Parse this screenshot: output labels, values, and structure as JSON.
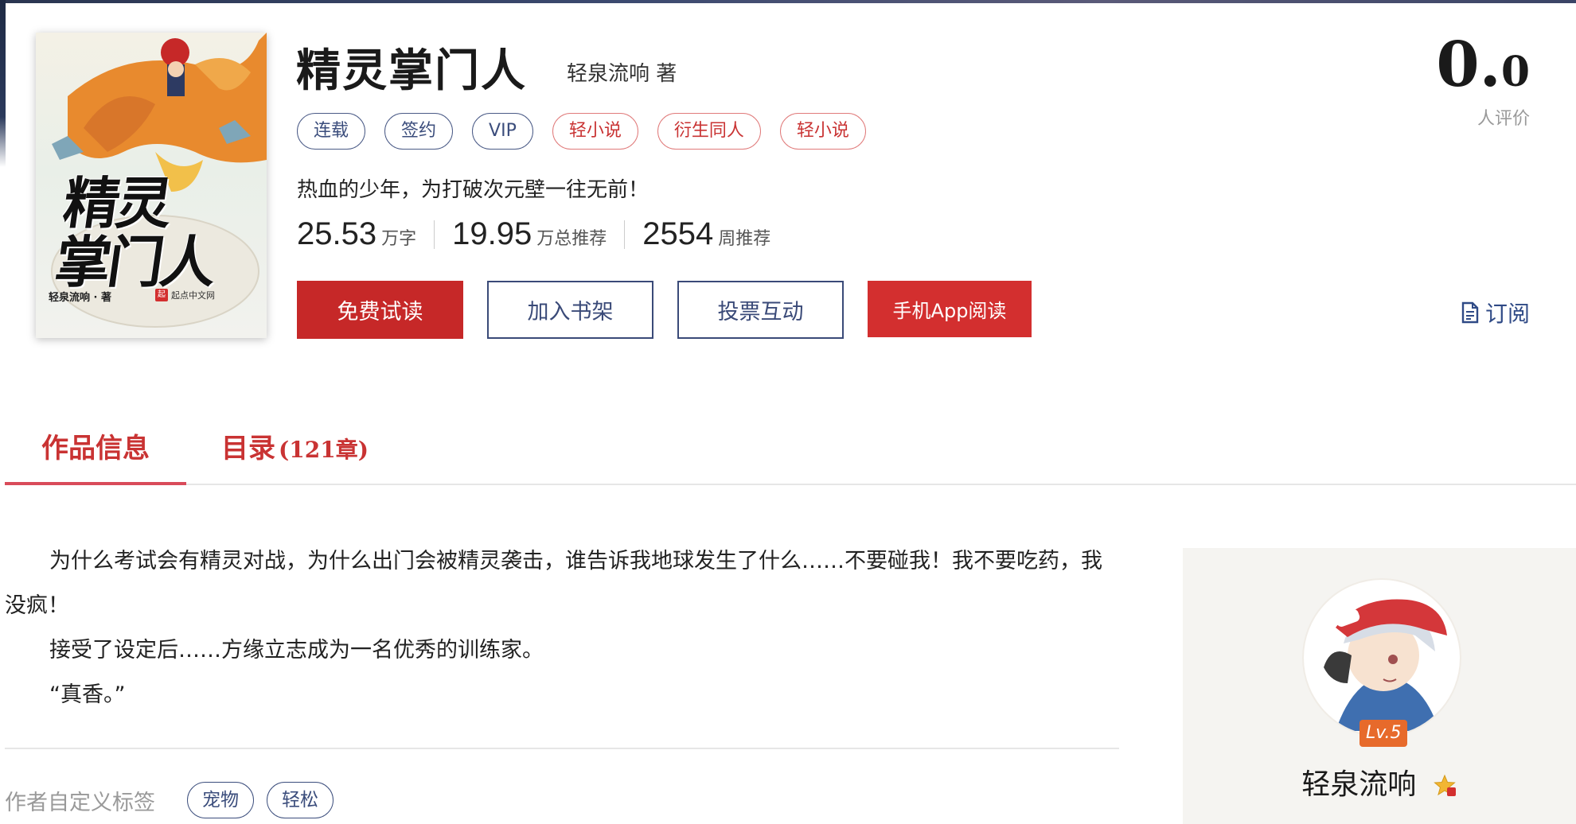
{
  "book": {
    "title": "精灵掌门人",
    "author_line": "轻泉流响 著",
    "intro": "热血的少年，为打破次元壁一往无前！",
    "cover": {
      "title_line1": "精灵",
      "title_line2": "掌门人",
      "author": "轻泉流响 · 著",
      "publisher": "起点中文网",
      "publisher_mark": "起"
    }
  },
  "tags": [
    {
      "label": "连载",
      "style": "blue"
    },
    {
      "label": "签约",
      "style": "blue"
    },
    {
      "label": "VIP",
      "style": "blue"
    },
    {
      "label": "轻小说",
      "style": "red"
    },
    {
      "label": "衍生同人",
      "style": "red"
    },
    {
      "label": "轻小说",
      "style": "red"
    }
  ],
  "stats": [
    {
      "value": "25.53",
      "unit": "万字"
    },
    {
      "value": "19.95",
      "unit": "万总推荐"
    },
    {
      "value": "2554",
      "unit": "周推荐"
    }
  ],
  "buttons": {
    "free_read": "免费试读",
    "add_shelf": "加入书架",
    "vote": "投票互动",
    "app_read": "手机App阅读"
  },
  "score": {
    "int": "0.",
    "dec": "0",
    "label": "人评价"
  },
  "subscribe": {
    "label": "订阅",
    "icon": "document-icon"
  },
  "tabs": {
    "info": "作品信息",
    "catalog": "目录",
    "catalog_count": "(121章)"
  },
  "description": [
    "为什么考试会有精灵对战，为什么出门会被精灵袭击，谁告诉我地球发生了什么……不要碰我！我不要吃药，我没疯！",
    "接受了设定后……方缘立志成为一名优秀的训练家。",
    "“真香。”"
  ],
  "custom_tags": {
    "label": "作者自定义标签",
    "items": [
      "宠物",
      "轻松"
    ]
  },
  "author_card": {
    "name": "轻泉流响",
    "level": "Lv.5"
  },
  "colors": {
    "primary_red": "#c62828",
    "navy": "#3a4a78",
    "tab_red": "#c93333"
  }
}
